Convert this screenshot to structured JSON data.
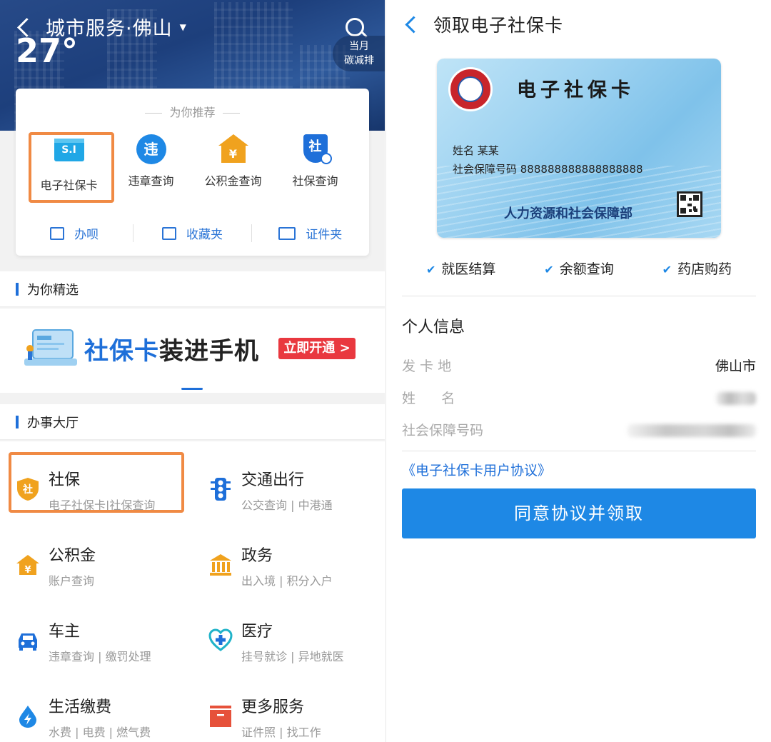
{
  "left": {
    "header": {
      "city_title": "城市服务·佛山",
      "caret": "▼",
      "temperature": "27°",
      "carbon_line1": "当月",
      "carbon_line2": "碳减排"
    },
    "recommend": {
      "title": "为你推荐",
      "items": [
        {
          "label": "电子社保卡",
          "icon": "si-card-icon",
          "icon_text": "S.I"
        },
        {
          "label": "违章查询",
          "icon": "violation-icon",
          "icon_text": "违"
        },
        {
          "label": "公积金查询",
          "icon": "housing-fund-icon",
          "icon_text": "¥"
        },
        {
          "label": "社保查询",
          "icon": "social-shield-icon",
          "icon_text": "社"
        }
      ],
      "links": [
        {
          "label": "办呗",
          "icon": "task-icon"
        },
        {
          "label": "收藏夹",
          "icon": "folder-icon"
        },
        {
          "label": "证件夹",
          "icon": "id-card-icon"
        }
      ]
    },
    "featured": {
      "section_title": "为你精选",
      "banner_highlight": "社保卡",
      "banner_rest": "装进手机",
      "banner_button": "立即开通 >"
    },
    "hall": {
      "section_title": "办事大厅",
      "services": [
        {
          "title": "社保",
          "sub": "电子社保卡|社保查询",
          "icon": "social-security-icon",
          "icon_text": "社"
        },
        {
          "title": "交通出行",
          "sub": "公交查询 | 中港通",
          "icon": "traffic-light-icon"
        },
        {
          "title": "公积金",
          "sub": "账户查询",
          "icon": "housing-fund-icon",
          "icon_text": "¥"
        },
        {
          "title": "政务",
          "sub": "出入境 | 积分入户",
          "icon": "government-building-icon"
        },
        {
          "title": "车主",
          "sub": "违章查询 | 缴罚处理",
          "icon": "car-icon"
        },
        {
          "title": "医疗",
          "sub": "挂号就诊 | 异地就医",
          "icon": "medical-heart-icon"
        },
        {
          "title": "生活缴费",
          "sub": "水费 | 电费 | 燃气费",
          "icon": "water-drop-icon"
        },
        {
          "title": "更多服务",
          "sub": "证件照 | 找工作",
          "icon": "more-services-icon"
        }
      ]
    }
  },
  "right": {
    "title": "领取电子社保卡",
    "card": {
      "title": "电子社保卡",
      "name_line": "姓名 某某",
      "number_line": "社会保障号码  888888888888888888",
      "issuer": "人力资源和社会保障部"
    },
    "features": [
      "就医结算",
      "余额查询",
      "药店购药"
    ],
    "personal_info": {
      "heading": "个人信息",
      "rows": [
        {
          "label": "发 卡 地",
          "value": "佛山市"
        },
        {
          "label": "姓      名",
          "value": ""
        },
        {
          "label": "社会保障号码",
          "value": ""
        }
      ]
    },
    "agreement_link": "《电子社保卡用户协议》",
    "agree_button": "同意协议并领取"
  },
  "colors": {
    "accent_blue": "#1e88e5",
    "highlight_orange": "#f08a44",
    "banner_red": "#e9383f"
  }
}
